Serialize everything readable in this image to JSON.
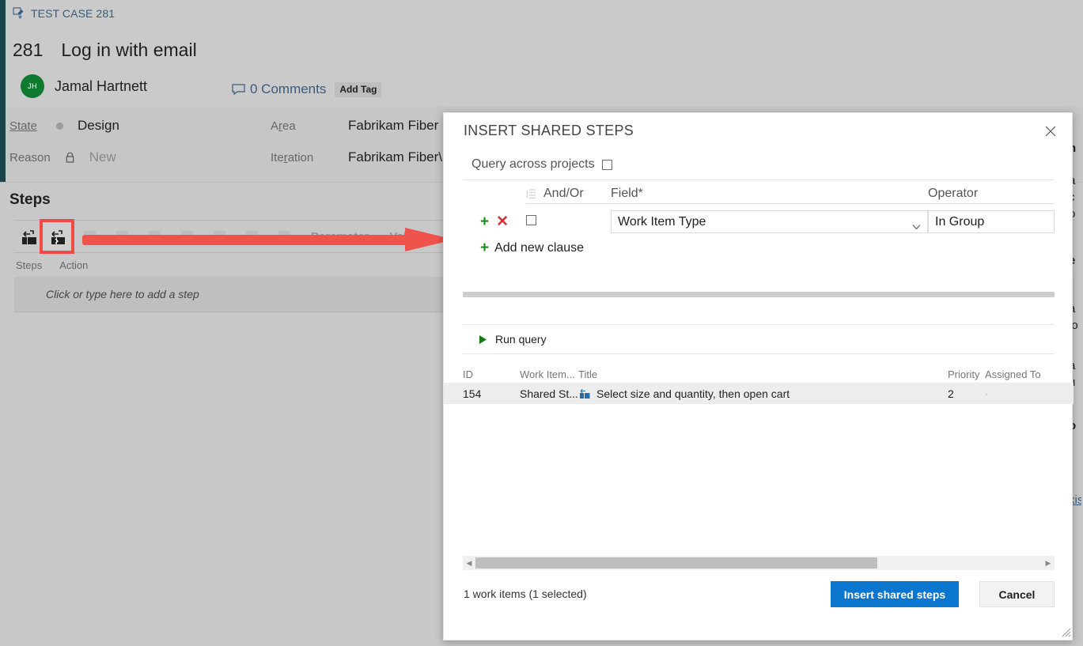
{
  "workitem": {
    "breadcrumb": "TEST CASE 281",
    "breadcrumb_icon": "test-case-icon",
    "id": "281",
    "title": "Log in with email",
    "author_initials": "JH",
    "author_name": "Jamal Hartnett",
    "comments_label": "0 Comments",
    "add_tag_label": "Add Tag",
    "fields": {
      "state_label": "State",
      "state_value": "Design",
      "reason_label": "Reason",
      "reason_value": "New",
      "area_label": "Area",
      "area_value": "Fabrikam Fiber",
      "iteration_label": "Iteration",
      "iteration_value": "Fabrikam Fiber\\F"
    }
  },
  "steps_section": {
    "heading": "Steps",
    "toolbar": {
      "insert_step_icon": "insert-step-icon",
      "insert_shared_steps_icon": "insert-shared-steps-icon",
      "ghost_label_1": "Parameter",
      "ghost_label_2": "Values"
    },
    "columns": [
      "Steps",
      "Action"
    ],
    "add_step_placeholder": "Click or type here to add a step"
  },
  "annotation": {
    "arrow_color": "#f04a44",
    "highlight_color": "#f04a44"
  },
  "background_right_fragments": [
    "n",
    "a",
    "c",
    "o",
    "e",
    "a",
    "lo",
    "a",
    "u",
    "o",
    "´",
    "kis"
  ],
  "dialog": {
    "title": "INSERT SHARED STEPS",
    "close_icon": "close-icon",
    "query_across_projects_label": "Query across projects",
    "query_across_projects_checked": false,
    "clause_headers": {
      "group_icon": "group-clauses-icon",
      "andor": "And/Or",
      "field": "Field*",
      "operator": "Operator"
    },
    "clause": {
      "add_icon": "plus-icon",
      "delete_icon": "delete-clause-icon",
      "group_checkbox_checked": false,
      "andor_value": "",
      "field_value": "Work Item Type",
      "operator_value": "In Group",
      "field_caret_icon": "chevron-down-icon"
    },
    "add_new_clause_label": "Add new clause",
    "run_query": {
      "icon": "play-icon",
      "label": "Run query"
    },
    "results": {
      "columns": [
        "ID",
        "Work Item...",
        "Title",
        "Priority",
        "Assigned To"
      ],
      "rows": [
        {
          "id": "154",
          "work_item_type": "Shared St...",
          "title_icon": "shared-steps-icon",
          "title": "Select size and quantity, then open cart",
          "priority": "2",
          "assigned_to": "·"
        }
      ]
    },
    "footer": {
      "status": "1 work items (1 selected)",
      "primary_button": "Insert shared steps",
      "secondary_button": "Cancel"
    },
    "accent_color": "#0b76cd"
  }
}
